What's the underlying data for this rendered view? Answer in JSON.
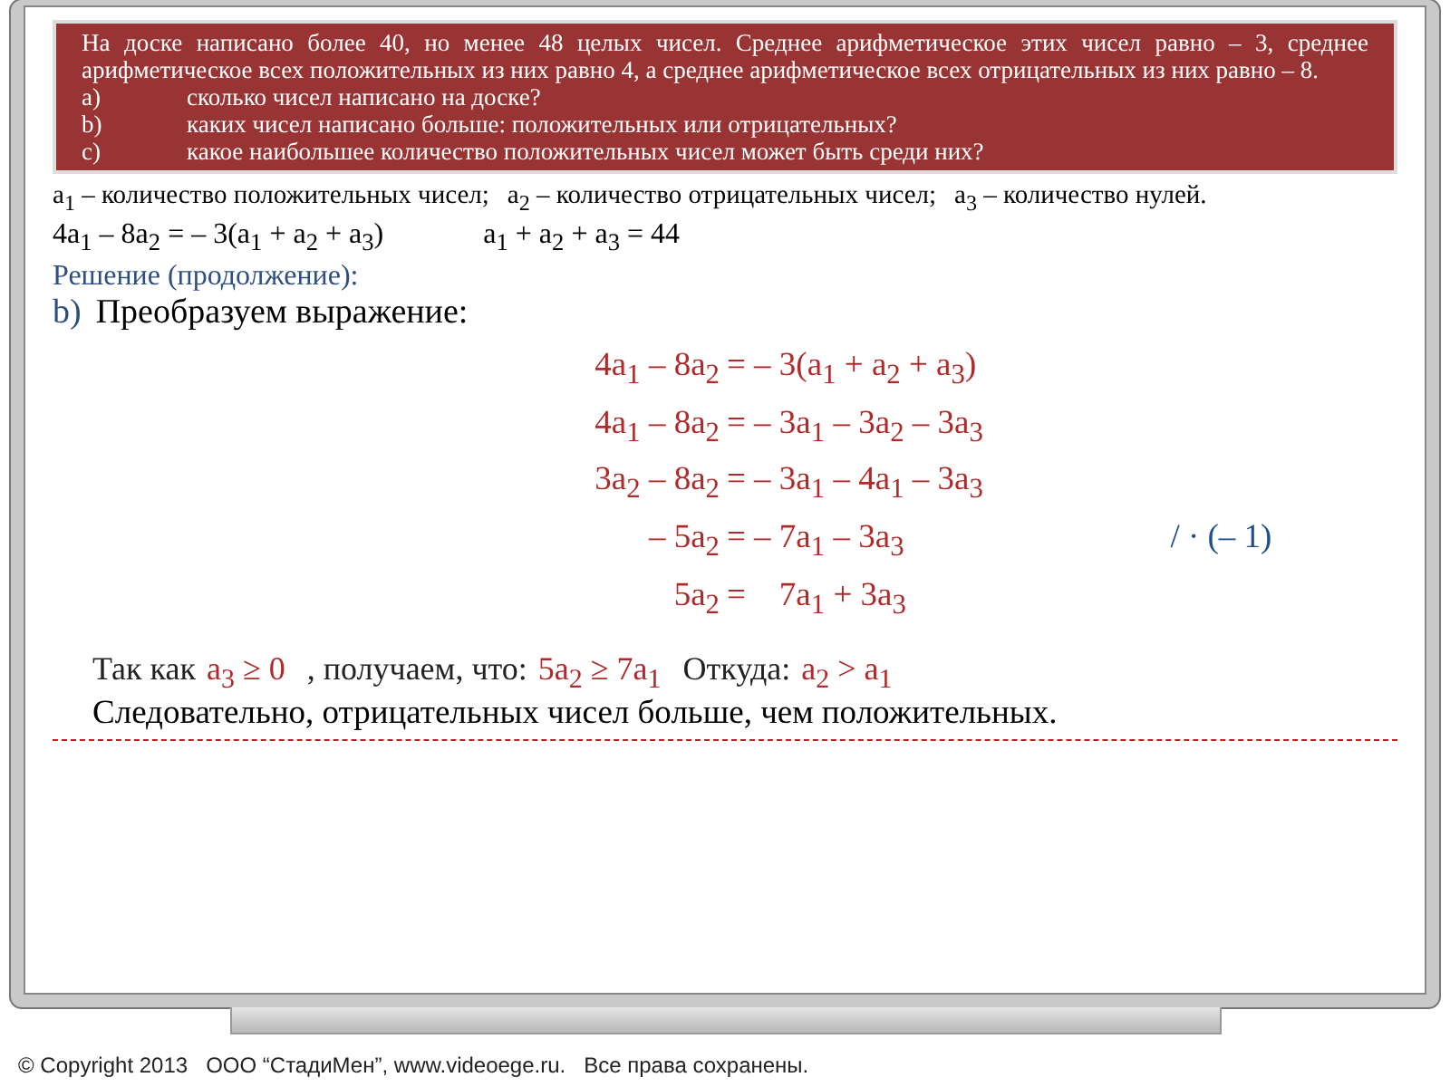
{
  "problem": {
    "text": "На доске написано более 40, но менее 48 целых чисел. Среднее арифметическое этих чисел равно – 3, среднее арифметическое всех положительных из них равно 4, а среднее арифметическое всех отрицательных из них равно – 8.",
    "questions": [
      {
        "marker": "a)",
        "text": "сколько чисел написано на доске?"
      },
      {
        "marker": "b)",
        "text": "каких чисел написано больше: положительных или отрицательных?"
      },
      {
        "marker": "c)",
        "text": "какое наибольшее количество положительных чисел может быть среди них?"
      }
    ]
  },
  "definitions": [
    "a$_{1}$ – количество положительных чисел;",
    "a$_{2}$ – количество отрицательных чисел;",
    "a$_{3}$ – количество нулей."
  ],
  "equations": [
    "4a$_{1}$ – 8a$_{2}$ = – 3(a$_{1}$ + a$_{2}$ + a$_{3}$)",
    "a$_{1}$ + a$_{2}$ + a$_{3}$ = 44"
  ],
  "solution_heading": "Решение (продолжение):",
  "part": {
    "marker": "b)",
    "text": "Преобразуем выражение:"
  },
  "steps": [
    {
      "left": "4a$_{1}$ – 8a$_{2}$",
      "right": "= – 3(a$_{1}$ + a$_{2}$ + a$_{3}$)"
    },
    {
      "left": "4a$_{1}$ – 8a$_{2}$",
      "right": "= – 3a$_{1}$ – 3a$_{2}$ – 3a$_{3}$"
    },
    {
      "left": "3a$_{2}$ – 8a$_{2}$",
      "right": "= – 3a$_{1}$ – 4a$_{1}$ – 3a$_{3}$"
    },
    {
      "left": "– 5a$_{2}$",
      "right": "= – 7a$_{1}$ – 3a$_{3}$",
      "note": "/ · (– 1)"
    },
    {
      "left": "5a$_{2}$",
      "right": "=    7a$_{1}$ + 3a$_{3}$"
    }
  ],
  "conclusion": [
    {
      "kind": "text",
      "text": "Так как"
    },
    {
      "kind": "math",
      "text": "a$_{3}$ ≥ 0"
    },
    {
      "kind": "text",
      "text": ", получаем, что:"
    },
    {
      "kind": "math",
      "text": "5a$_{2}$ ≥ 7a$_{1}$"
    },
    {
      "kind": "text",
      "text": "Откуда:"
    },
    {
      "kind": "math",
      "text": "a$_{2}$ > a$_{1}$"
    }
  ],
  "final": "Следовательно, отрицательных чисел больше, чем положительных.",
  "footer": "© Copyright 2013   ООО “СтадиМен”, www.videoege.ru.   Все права сохранены."
}
